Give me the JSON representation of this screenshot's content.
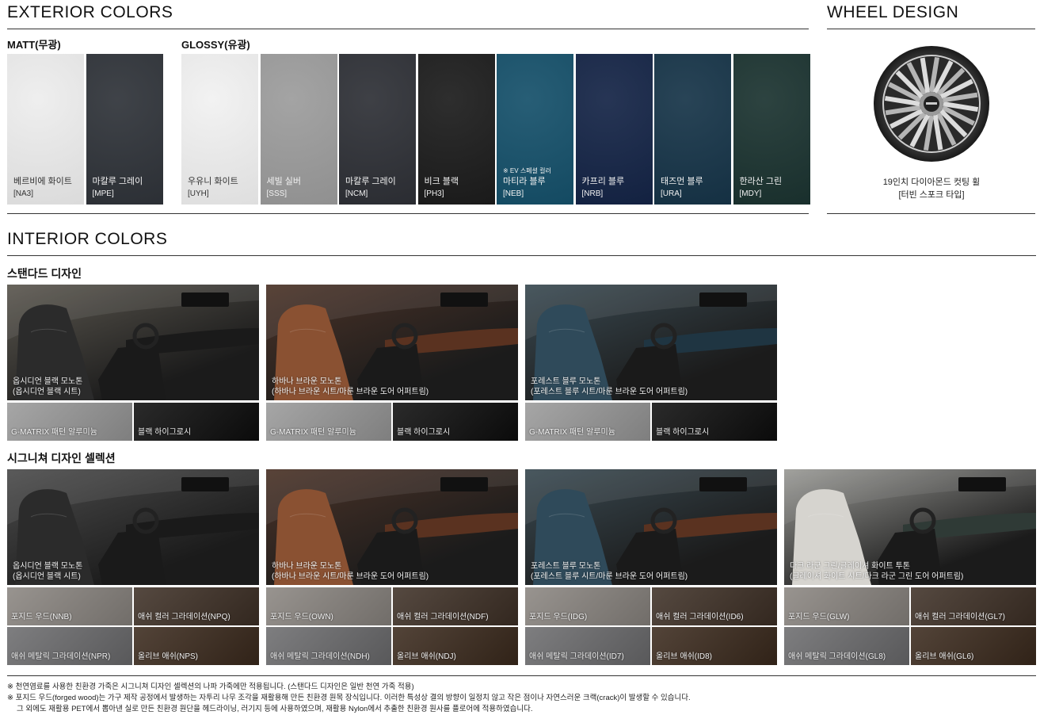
{
  "exterior": {
    "title": "EXTERIOR COLORS",
    "matt_label": "MATT(무광)",
    "glossy_label": "GLOSSY(유광)",
    "matt": [
      {
        "name": "베르비에 화이트",
        "code": "[NA3]",
        "color": "#ededed",
        "tone": "light"
      },
      {
        "name": "마칼루 그레이",
        "code": "[MPE]",
        "color": "#2f3339",
        "tone": "dark"
      }
    ],
    "glossy": [
      {
        "name": "우유니 화이트",
        "code": "[UYH]",
        "color": "#f1f1f1",
        "tone": "light"
      },
      {
        "name": "세빌 실버",
        "code": "[SSS]",
        "color": "#9c9c9c",
        "tone": "dark"
      },
      {
        "name": "마칼루 그레이",
        "code": "[NCM]",
        "color": "#2e3036",
        "tone": "dark"
      },
      {
        "name": "비크 블랙",
        "code": "[PH3]",
        "color": "#1c1c1c",
        "tone": "dark"
      },
      {
        "name": "마티라 블루",
        "code": "[NEB]",
        "color": "#15506a",
        "tone": "dark",
        "note": "※ EV 스페셜 컬러"
      },
      {
        "name": "카프리 블루",
        "code": "[NRB]",
        "color": "#142446",
        "tone": "dark"
      },
      {
        "name": "태즈먼 블루",
        "code": "[URA]",
        "color": "#163448",
        "tone": "dark"
      },
      {
        "name": "한라산 그린",
        "code": "[MDY]",
        "color": "#1b3330",
        "tone": "dark"
      }
    ]
  },
  "wheel": {
    "title": "WHEEL DESIGN",
    "name_line1": "19인치 다이아몬드 컷팅 휠",
    "name_line2": "[터빈 스포크 타입]"
  },
  "interior": {
    "title": "INTERIOR COLORS",
    "standard": {
      "label": "스탠다드 디자인",
      "items": [
        {
          "line1": "옵시디언 블랙 모노톤",
          "line2": "(옵시디언 블랙 시트)",
          "seat": "#2b2b2b",
          "trim": "#1a1a1a",
          "bg": "#5b574f",
          "tiles": [
            {
              "label": "G-MATRIX 패턴 알루미늄",
              "color": "#9a9a9a"
            },
            {
              "label": "블랙 하이그로시",
              "color": "#0d0d0d"
            }
          ]
        },
        {
          "line1": "하바나 브라운 모노톤",
          "line2": "(하바나 브라운 시트/마룬 브라운 도어 어퍼트림)",
          "seat": "#8a5132",
          "trim": "#5a3220",
          "bg": "#4b3328",
          "tiles": [
            {
              "label": "G-MATRIX 패턴 알루미늄",
              "color": "#9a9a9a"
            },
            {
              "label": "블랙 하이그로시",
              "color": "#0d0d0d"
            }
          ]
        },
        {
          "line1": "포레스트 블루 모노톤",
          "line2": "(포레스트 블루 시트/마룬 브라운 도어 어퍼트림)",
          "seat": "#2f4a5a",
          "trim": "#1f3542",
          "bg": "#3a4a52",
          "tiles": [
            {
              "label": "G-MATRIX 패턴 알루미늄",
              "color": "#9a9a9a"
            },
            {
              "label": "블랙 하이그로시",
              "color": "#0d0d0d"
            }
          ]
        }
      ]
    },
    "signature": {
      "label": "시그니쳐 디자인 셀렉션",
      "items": [
        {
          "line1": "옵시디언 블랙 모노톤",
          "line2": "(옵시디언 블랙 시트)",
          "seat": "#2b2b2b",
          "trim": "#1a1a1a",
          "bg": "#4c4c4c",
          "tiles": [
            {
              "label": "포지드 우드(NNB)",
              "color": "#8a8580"
            },
            {
              "label": "애쉬 컬러 그라데이션(NPQ)",
              "color": "#3e3026"
            },
            {
              "label": "애쉬 메탈릭 그라데이션(NPR)",
              "color": "#6c6c6e"
            },
            {
              "label": "올리브 애쉬(NPS)",
              "color": "#3b2a1d"
            }
          ]
        },
        {
          "line1": "하바나 브라운 모노톤",
          "line2": "(하바나 브라운 시트/마룬 브라운 도어 어퍼트림)",
          "seat": "#8a5132",
          "trim": "#5a3220",
          "bg": "#4b3328",
          "tiles": [
            {
              "label": "포지드 우드(OWN)",
              "color": "#8a8580"
            },
            {
              "label": "애쉬 컬러 그라데이션(NDF)",
              "color": "#3e3026"
            },
            {
              "label": "애쉬 메탈릭 그라데이션(NDH)",
              "color": "#6c6c6e"
            },
            {
              "label": "올리브 애쉬(NDJ)",
              "color": "#3b2a1d"
            }
          ]
        },
        {
          "line1": "포레스트 블루 모노톤",
          "line2": "(포레스트 블루 시트/마룬 브라운 도어 어퍼트림)",
          "seat": "#2f4a5a",
          "trim": "#5a3220",
          "bg": "#3a4a52",
          "tiles": [
            {
              "label": "포지드 우드(IDG)",
              "color": "#8a8580"
            },
            {
              "label": "애쉬 컬러 그라데이션(ID6)",
              "color": "#3e3026"
            },
            {
              "label": "애쉬 메탈릭 그라데이션(ID7)",
              "color": "#6c6c6e"
            },
            {
              "label": "올리브 애쉬(ID8)",
              "color": "#3b2a1d"
            }
          ]
        },
        {
          "line1": "다크 라군 그린/글레이셔 화이트 투톤",
          "line2": "(글레이셔 화이트 시트/다크 라군 그린 도어 어퍼트림)",
          "seat": "#d6d4cf",
          "trim": "#2f3a36",
          "bg": "#9a9a96",
          "tiles": [
            {
              "label": "포지드 우드(GLW)",
              "color": "#8a8580"
            },
            {
              "label": "애쉬 컬러 그라데이션(GL7)",
              "color": "#3e3026"
            },
            {
              "label": "애쉬 메탈릭 그라데이션(GL8)",
              "color": "#6c6c6e"
            },
            {
              "label": "올리브 애쉬(GL6)",
              "color": "#3b2a1d"
            }
          ]
        }
      ]
    }
  },
  "footnotes": [
    "※ 천연염료를 사용한 친환경 가죽은 시그니쳐 디자인 셀렉션의 나파 가죽에만 적용됩니다. (스탠다드 디자인은 일반 천연 가죽 적용)",
    "※ 포지드 우드(forged wood)는 가구 제작 공정에서 발생하는 자투리 나무 조각을 재활용해 만든 친환경 원목 장식입니다. 이러한 특성상 결의 방향이 일정치 않고 작은 점이나 자연스러운 크랙(crack)이 발생할 수 있습니다.",
    "그 외에도 재활용 PET에서 뽑아낸 실로 만든 친환경 원단을 헤드라이닝, 러기지 등에 사용하였으며, 재활용 Nylon에서 추출한 친환경 원사를 플로어에 적용하였습니다."
  ]
}
